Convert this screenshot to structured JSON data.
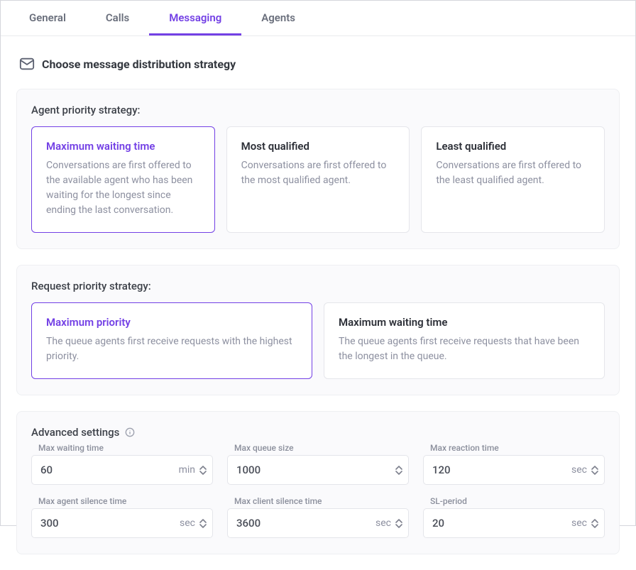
{
  "tabs": [
    {
      "label": "General",
      "active": false
    },
    {
      "label": "Calls",
      "active": false
    },
    {
      "label": "Messaging",
      "active": true
    },
    {
      "label": "Agents",
      "active": false
    }
  ],
  "header": {
    "title": "Choose message distribution strategy"
  },
  "agent_priority": {
    "label": "Agent priority strategy:",
    "options": [
      {
        "title": "Maximum waiting time",
        "desc": "Conversations are first offered to the available agent who has been waiting for the longest since ending the last conversation.",
        "selected": true
      },
      {
        "title": "Most qualified",
        "desc": "Conversations are first offered to the most qualified agent.",
        "selected": false
      },
      {
        "title": "Least qualified",
        "desc": "Conversations are first offered to the least qualified agent.",
        "selected": false
      }
    ]
  },
  "request_priority": {
    "label": "Request priority strategy:",
    "options": [
      {
        "title": "Maximum priority",
        "desc": "The queue agents first receive requests with the highest priority.",
        "selected": true
      },
      {
        "title": "Maximum waiting time",
        "desc": "The queue agents first receive requests that have been the longest in the queue.",
        "selected": false
      }
    ]
  },
  "advanced": {
    "label": "Advanced settings",
    "fields": [
      {
        "label": "Max waiting time",
        "value": "60",
        "unit": "min"
      },
      {
        "label": "Max queue size",
        "value": "1000",
        "unit": ""
      },
      {
        "label": "Max reaction time",
        "value": "120",
        "unit": "sec"
      },
      {
        "label": "Max agent silence time",
        "value": "300",
        "unit": "sec"
      },
      {
        "label": "Max client silence time",
        "value": "3600",
        "unit": "sec"
      },
      {
        "label": "SL-period",
        "value": "20",
        "unit": "sec"
      }
    ]
  }
}
